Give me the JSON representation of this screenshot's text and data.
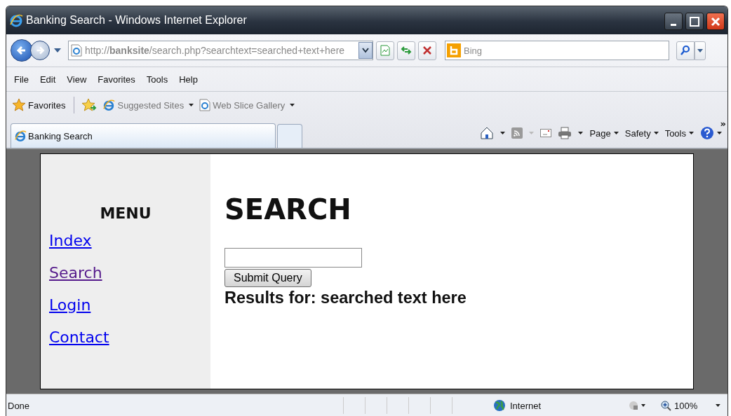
{
  "window": {
    "title": "Banking Search - Windows Internet Explorer"
  },
  "address_bar": {
    "url": "http://**banksite**/search.php?searchtext=searched+text+here"
  },
  "search_box": {
    "placeholder": "Bing"
  },
  "menu_bar": [
    "File",
    "Edit",
    "View",
    "Favorites",
    "Tools",
    "Help"
  ],
  "favorites_bar": [
    {
      "label": "Favorites",
      "kind": "favorites"
    },
    {
      "label": "Suggested Sites",
      "kind": "ie-link"
    },
    {
      "label": "Web Slice Gallery",
      "kind": "page-link"
    }
  ],
  "tabs": [
    {
      "label": "Banking Search",
      "selected": true
    }
  ],
  "command_bar": {
    "menus": [
      "Page",
      "Safety",
      "Tools"
    ],
    "overflow": "»"
  },
  "page": {
    "menu_title": "MENU",
    "menu_links": [
      {
        "label": "Index",
        "visited": false
      },
      {
        "label": "Search",
        "visited": true
      },
      {
        "label": "Login",
        "visited": false
      },
      {
        "label": "Contact",
        "visited": false
      }
    ],
    "heading": "SEARCH",
    "submit_button": "Submit Query",
    "results": "Results for: searched text here"
  },
  "status_bar": {
    "status": "Done",
    "zone": "Internet",
    "zoom": "100%"
  }
}
